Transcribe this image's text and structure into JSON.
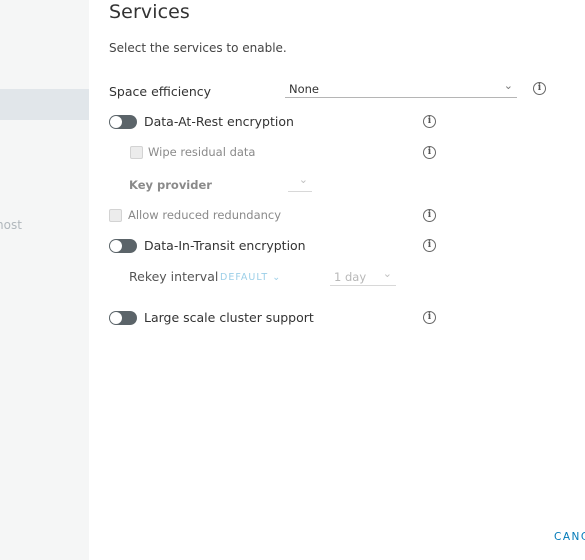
{
  "sidebar": {
    "partial_step_label": "host"
  },
  "page": {
    "title": "Services",
    "subtitle": "Select the services to enable."
  },
  "space_efficiency": {
    "label": "Space efficiency",
    "value": "None"
  },
  "data_at_rest": {
    "label": "Data-At-Rest encryption",
    "enabled": false,
    "wipe_label": "Wipe residual data",
    "key_provider_label": "Key provider",
    "key_provider_value": ""
  },
  "allow_reduced_redundancy": {
    "label": "Allow reduced redundancy",
    "checked": false
  },
  "data_in_transit": {
    "label": "Data-In-Transit encryption",
    "enabled": false,
    "rekey_label": "Rekey interval",
    "rekey_default_button": "DEFAULT",
    "rekey_value": "1 day"
  },
  "large_scale": {
    "label": "Large scale cluster support",
    "enabled": false
  },
  "footer": {
    "cancel_label": "CANCEL"
  },
  "icons": {
    "info": "info-circle-icon",
    "chevron": "chevron-down-icon"
  }
}
